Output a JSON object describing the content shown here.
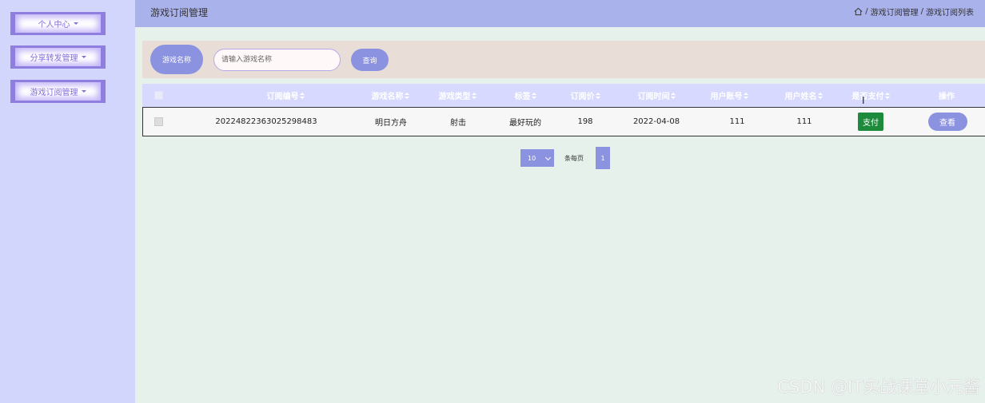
{
  "sidebar": {
    "items": [
      {
        "label": "个人中心"
      },
      {
        "label": "分享转发管理"
      },
      {
        "label": "游戏订阅管理"
      }
    ]
  },
  "header": {
    "title": "游戏订阅管理",
    "breadcrumb": [
      "游戏订阅管理",
      "游戏订阅列表"
    ],
    "home_icon": "home-icon"
  },
  "search": {
    "label": "游戏名称",
    "placeholder": "请输入游戏名称",
    "value": "",
    "button": "查询"
  },
  "table": {
    "columns": [
      "订阅编号",
      "游戏名称",
      "游戏类型",
      "标签",
      "订阅价",
      "订阅时间",
      "用户账号",
      "用户姓名",
      "是否支付",
      "操作"
    ],
    "rows": [
      {
        "order_no": "20224822363025298483",
        "game_name": "明日方舟",
        "game_type": "射击",
        "tag": "最好玩的",
        "price": "198",
        "time": "2022-04-08",
        "account": "111",
        "username": "111",
        "paid": "支付",
        "action": "查看"
      }
    ]
  },
  "pagination": {
    "page_size": "10",
    "per_page_label": "条每页",
    "current_page": "1"
  },
  "colors": {
    "accent": "#8b92df",
    "sidebar_bg": "#d2d6fc",
    "header_bg": "#aab2eb",
    "paid_green": "#1e8a3c"
  },
  "watermark": "CSDN @IT实战课堂小元酱"
}
